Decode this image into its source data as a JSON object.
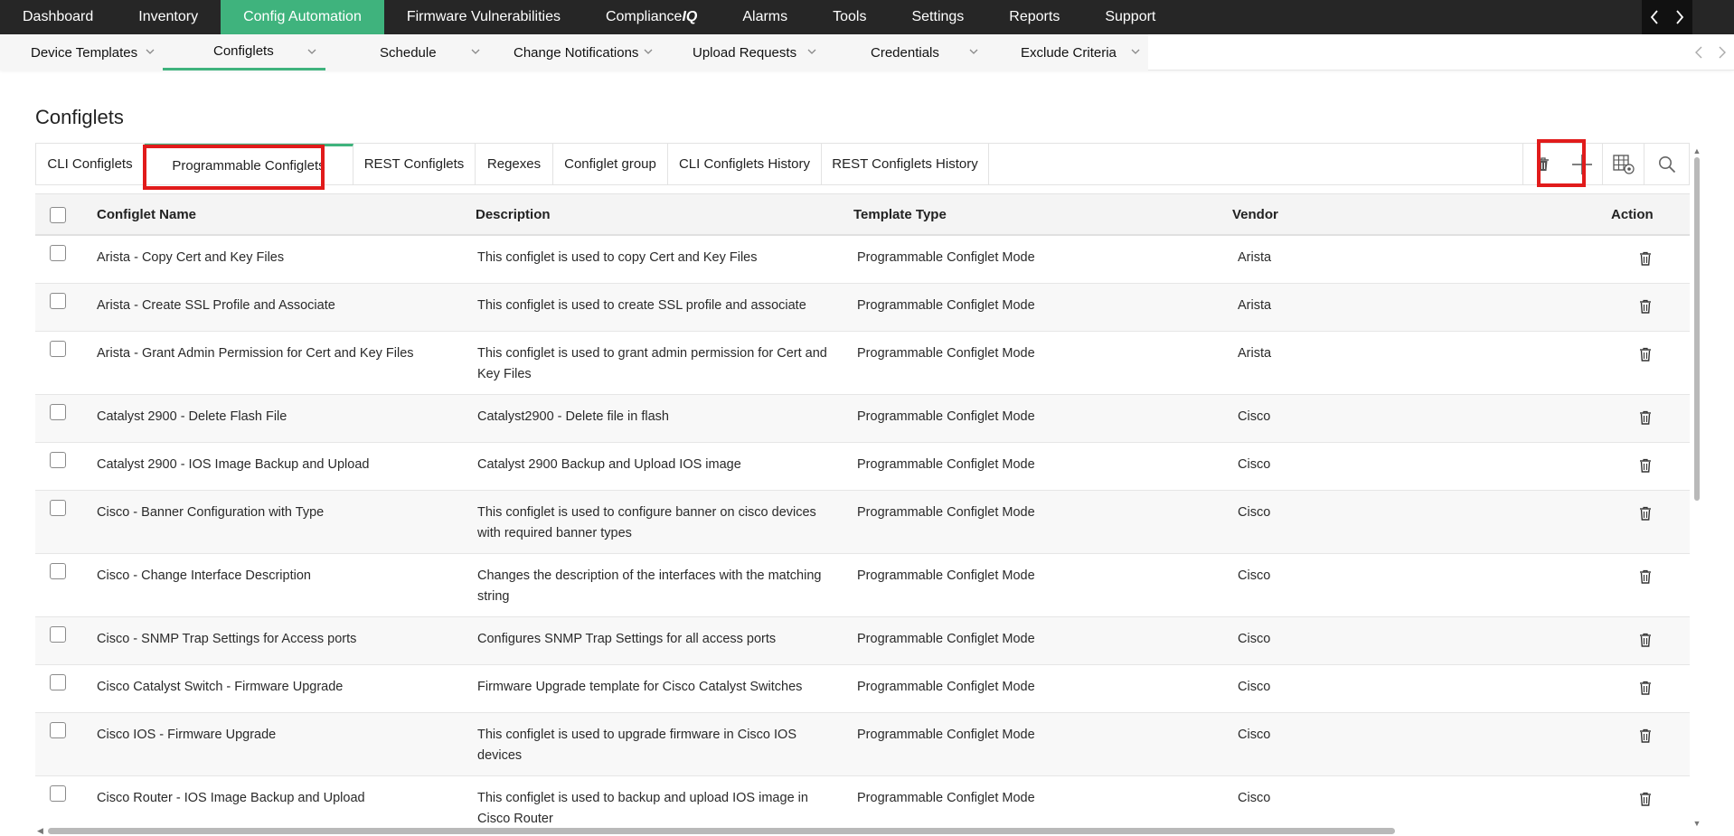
{
  "top_nav": {
    "items": [
      {
        "label": "Dashboard"
      },
      {
        "label": "Inventory"
      },
      {
        "label": "Config Automation",
        "active": true
      },
      {
        "label": "Firmware Vulnerabilities"
      },
      {
        "label_prefix": "Compliance",
        "label_suffix": "IQ"
      },
      {
        "label": "Alarms"
      },
      {
        "label": "Tools"
      },
      {
        "label": "Settings"
      },
      {
        "label": "Reports"
      },
      {
        "label": "Support"
      }
    ],
    "accent_color": "#3fb37d",
    "arrow_icons": [
      "chevron-left-icon",
      "chevron-right-icon"
    ]
  },
  "sub_nav": {
    "items": [
      {
        "label": "Device Templates"
      },
      {
        "label": "Configlets",
        "active": true
      },
      {
        "label": "Schedule"
      },
      {
        "label": "Change Notifications"
      },
      {
        "label": "Upload Requests"
      },
      {
        "label": "Credentials"
      },
      {
        "label": "Exclude Criteria"
      }
    ]
  },
  "page": {
    "title": "Configlets"
  },
  "tabs": [
    {
      "label": "CLI Configlets"
    },
    {
      "label": "Programmable Configlets",
      "active": true,
      "highlighted": true
    },
    {
      "label": "REST Configlets"
    },
    {
      "label": "Regexes"
    },
    {
      "label": "Configlet group"
    },
    {
      "label": "CLI Configlets History"
    },
    {
      "label": "REST Configlets History"
    }
  ],
  "toolbar": {
    "icons": [
      "trash-icon",
      "plus-icon",
      "column-settings-icon",
      "search-icon"
    ],
    "highlighted_icon": "plus-icon",
    "highlight_color": "#e11b1b"
  },
  "table": {
    "columns": {
      "name": "Configlet Name",
      "description": "Description",
      "template_type": "Template Type",
      "vendor": "Vendor",
      "action": "Action"
    },
    "rows": [
      {
        "name": "Arista - Copy Cert and Key Files",
        "description": "This configlet is used to copy Cert and Key Files",
        "template_type": "Programmable Configlet Mode",
        "vendor": "Arista"
      },
      {
        "name": "Arista - Create SSL Profile and Associate",
        "description": "This configlet is used to create SSL profile and associate",
        "template_type": "Programmable Configlet Mode",
        "vendor": "Arista"
      },
      {
        "name": "Arista - Grant Admin Permission for Cert and Key Files",
        "description": "This configlet is used to grant admin permission for Cert and Key Files",
        "template_type": "Programmable Configlet Mode",
        "vendor": "Arista"
      },
      {
        "name": "Catalyst 2900 - Delete Flash File",
        "description": "Catalyst2900 - Delete file in flash",
        "template_type": "Programmable Configlet Mode",
        "vendor": "Cisco"
      },
      {
        "name": "Catalyst 2900 - IOS Image Backup and Upload",
        "description": "Catalyst 2900 Backup and Upload IOS image",
        "template_type": "Programmable Configlet Mode",
        "vendor": "Cisco"
      },
      {
        "name": "Cisco - Banner Configuration with Type",
        "description": "This configlet is used to configure banner on cisco devices with required banner types",
        "template_type": "Programmable Configlet Mode",
        "vendor": "Cisco"
      },
      {
        "name": "Cisco - Change Interface Description",
        "description": "Changes the description of the interfaces with the matching string",
        "template_type": "Programmable Configlet Mode",
        "vendor": "Cisco"
      },
      {
        "name": "Cisco - SNMP Trap Settings for Access ports",
        "description": "Configures SNMP Trap Settings for all access ports",
        "template_type": "Programmable Configlet Mode",
        "vendor": "Cisco"
      },
      {
        "name": "Cisco Catalyst Switch - Firmware Upgrade",
        "description": "Firmware Upgrade template for Cisco Catalyst Switches",
        "template_type": "Programmable Configlet Mode",
        "vendor": "Cisco"
      },
      {
        "name": "Cisco IOS - Firmware Upgrade",
        "description": "This configlet is used to upgrade firmware in Cisco IOS devices",
        "template_type": "Programmable Configlet Mode",
        "vendor": "Cisco"
      },
      {
        "name": "Cisco Router - IOS Image Backup and Upload",
        "description": "This configlet is used to backup and upload IOS image in Cisco Router",
        "template_type": "Programmable Configlet Mode",
        "vendor": "Cisco"
      }
    ],
    "row_action_icon": "trash-icon"
  }
}
